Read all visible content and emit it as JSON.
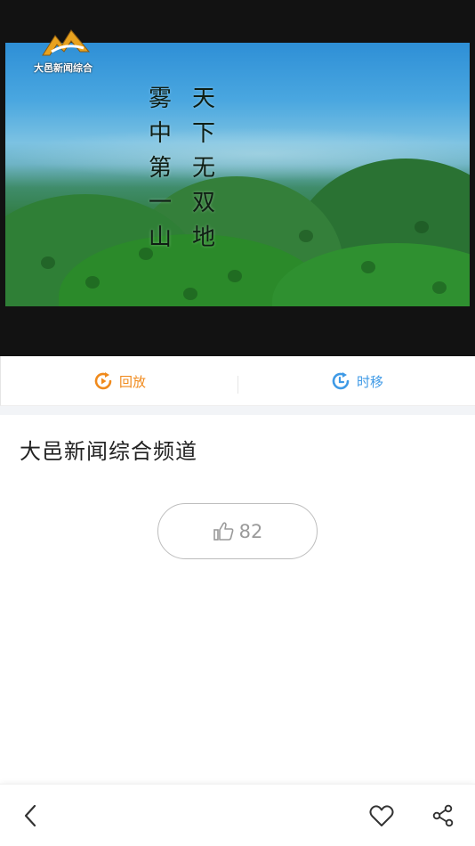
{
  "player": {
    "channel_logo_text": "大邑新闻综合",
    "overlay_poem_right": [
      "天",
      "下",
      "无",
      "双",
      "地"
    ],
    "overlay_poem_left": [
      "雾",
      "中",
      "第",
      "一",
      "山"
    ]
  },
  "modes": {
    "replay_label": "回放",
    "timeshift_label": "时移",
    "replay_color": "#f08a1c",
    "timeshift_color": "#3f9ae6"
  },
  "channel": {
    "title": "大邑新闻综合频道"
  },
  "like": {
    "count": "82"
  },
  "toolbar": {
    "icons": [
      "back-icon",
      "heart-icon",
      "share-icon"
    ]
  }
}
